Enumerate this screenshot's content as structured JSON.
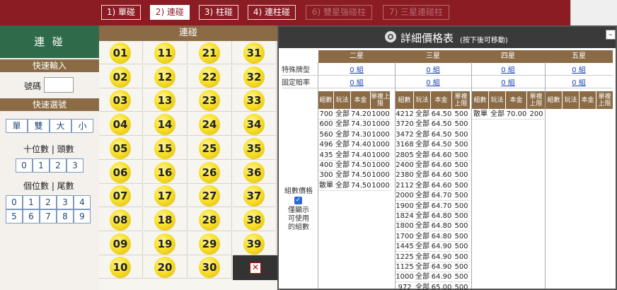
{
  "tabs": [
    {
      "label": "1) 單碰",
      "state": "normal"
    },
    {
      "label": "2) 連碰",
      "state": "active"
    },
    {
      "label": "3) 柱碰",
      "state": "normal"
    },
    {
      "label": "4) 連柱碰",
      "state": "normal"
    },
    {
      "label": "6) 雙星強碰柱",
      "state": "disabled"
    },
    {
      "label": "7) 三星連碰柱",
      "state": "disabled"
    }
  ],
  "left": {
    "title": "連 碰",
    "quick_input": "快速輸入",
    "number_label": "號碼",
    "number_value": "",
    "quick_select": "快速選號",
    "parity": [
      "單",
      "雙",
      "大",
      "小"
    ],
    "tens_label": "十位數 | 頭數",
    "tens": [
      "0",
      "1",
      "2",
      "3"
    ],
    "ones_label": "個位數 | 尾數",
    "ones": [
      "0",
      "1",
      "2",
      "3",
      "4",
      "5",
      "6",
      "7",
      "8",
      "9"
    ]
  },
  "grid": {
    "header": "連碰",
    "columns": [
      [
        "01",
        "02",
        "03",
        "04",
        "05",
        "06",
        "07",
        "08",
        "09",
        "10"
      ],
      [
        "11",
        "12",
        "13",
        "14",
        "15",
        "16",
        "17",
        "18",
        "19",
        "20"
      ],
      [
        "21",
        "22",
        "23",
        "24",
        "25",
        "26",
        "27",
        "28",
        "29",
        "30"
      ],
      [
        "31",
        "32",
        "33",
        "34",
        "35",
        "36",
        "37",
        "38",
        "39"
      ]
    ],
    "close_symbol": "✕"
  },
  "modal": {
    "title": "詳細價格表",
    "subtitle": "(按下後可移動)",
    "min_symbol": "–",
    "sections": [
      "二星",
      "三星",
      "四星",
      "五星"
    ],
    "special_label": "特殊牌型",
    "fixed_label": "固定賠率",
    "special_links": [
      "0 組",
      "0 組",
      "0 組",
      "0 組"
    ],
    "fixed_links": [
      "0 組",
      "0 組",
      "0 組",
      "0 組"
    ],
    "side_label": "組數價格",
    "side_note": "僅顯示可使用的組數",
    "col_headers": [
      "組數",
      "玩法",
      "本金",
      "單複上限"
    ],
    "two_star": [
      [
        "700",
        "全部",
        "74.20",
        "1000"
      ],
      [
        "600",
        "全部",
        "74.30",
        "1000"
      ],
      [
        "560",
        "全部",
        "74.30",
        "1000"
      ],
      [
        "496",
        "全部",
        "74.40",
        "1000"
      ],
      [
        "435",
        "全部",
        "74.40",
        "1000"
      ],
      [
        "400",
        "全部",
        "74.50",
        "1000"
      ],
      [
        "300",
        "全部",
        "74.50",
        "1000"
      ],
      [
        "散單",
        "全部",
        "74.50",
        "1000"
      ]
    ],
    "three_star": [
      [
        "4212",
        "全部",
        "64.50",
        "500"
      ],
      [
        "3720",
        "全部",
        "64.50",
        "500"
      ],
      [
        "3472",
        "全部",
        "64.50",
        "500"
      ],
      [
        "3168",
        "全部",
        "64.50",
        "500"
      ],
      [
        "2805",
        "全部",
        "64.60",
        "500"
      ],
      [
        "2400",
        "全部",
        "64.60",
        "500"
      ],
      [
        "2380",
        "全部",
        "64.60",
        "500"
      ],
      [
        "2112",
        "全部",
        "64.60",
        "500"
      ],
      [
        "2000",
        "全部",
        "64.70",
        "500"
      ],
      [
        "1900",
        "全部",
        "64.70",
        "500"
      ],
      [
        "1824",
        "全部",
        "64.80",
        "500"
      ],
      [
        "1800",
        "全部",
        "64.80",
        "500"
      ],
      [
        "1700",
        "全部",
        "64.80",
        "500"
      ],
      [
        "1445",
        "全部",
        "64.90",
        "500"
      ],
      [
        "1225",
        "全部",
        "64.90",
        "500"
      ],
      [
        "1125",
        "全部",
        "64.90",
        "500"
      ],
      [
        "1000",
        "全部",
        "64.90",
        "500"
      ],
      [
        "972",
        "全部",
        "65.00",
        "500"
      ]
    ],
    "four_star": [
      [
        "散單",
        "全部",
        "70.00",
        "200"
      ]
    ]
  }
}
